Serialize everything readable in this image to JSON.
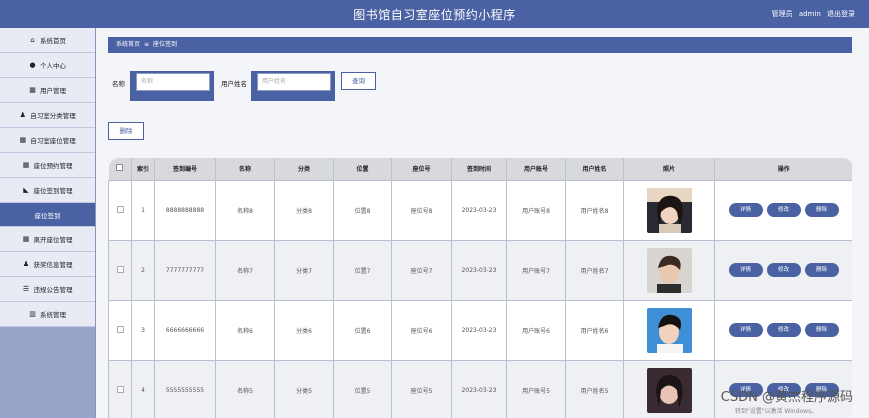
{
  "header": {
    "title": "图书馆自习室座位预约小程序",
    "user_role": "管理员",
    "username": "admin",
    "logout": "退出登录"
  },
  "sidebar": {
    "items": [
      {
        "icon": "home-icon",
        "label": "系统首页"
      },
      {
        "icon": "user-icon",
        "label": "个人中心"
      },
      {
        "icon": "grid-icon",
        "label": "用户管理"
      },
      {
        "icon": "person-icon",
        "label": "自习室分类管理"
      },
      {
        "icon": "grid-icon",
        "label": "自习室座位管理"
      },
      {
        "icon": "grid-icon",
        "label": "座位预约管理"
      },
      {
        "icon": "thumb-icon",
        "label": "座位签到管理"
      },
      {
        "icon": "",
        "label": "座位签到"
      },
      {
        "icon": "grid-icon",
        "label": "离开座位管理"
      },
      {
        "icon": "person-icon",
        "label": "获奖信息管理"
      },
      {
        "icon": "sliders-icon",
        "label": "违规公告管理"
      },
      {
        "icon": "chart-icon",
        "label": "系统管理"
      }
    ],
    "active_index": 7
  },
  "breadcrumb": {
    "home": "系统首页",
    "sep": "≡",
    "current": "座位签到"
  },
  "search": {
    "name_label": "名称",
    "name_placeholder": "名称",
    "user_label": "用户姓名",
    "user_placeholder": "用户姓名",
    "query_button": "查询"
  },
  "delete_button": "删除",
  "table": {
    "headers": [
      "",
      "索引",
      "签到编号",
      "名称",
      "分类",
      "位置",
      "座位号",
      "签到时间",
      "用户账号",
      "用户姓名",
      "照片",
      "操作"
    ],
    "ops": [
      "详情",
      "修改",
      "删除"
    ],
    "rows": [
      {
        "index": "1",
        "code": "8888888888",
        "name": "名称8",
        "category": "分类8",
        "location": "位置8",
        "seat": "座位号8",
        "time": "2023-03-23",
        "account": "用户账号8",
        "user": "用户姓名8"
      },
      {
        "index": "2",
        "code": "7777777777",
        "name": "名称7",
        "category": "分类7",
        "location": "位置7",
        "seat": "座位号7",
        "time": "2023-03-23",
        "account": "用户账号7",
        "user": "用户姓名7"
      },
      {
        "index": "3",
        "code": "6666666666",
        "name": "名称6",
        "category": "分类6",
        "location": "位置6",
        "seat": "座位号6",
        "time": "2023-03-23",
        "account": "用户账号6",
        "user": "用户姓名6"
      },
      {
        "index": "4",
        "code": "5555555555",
        "name": "名称5",
        "category": "分类5",
        "location": "位置5",
        "seat": "座位号5",
        "time": "2023-03-23",
        "account": "用户账号5",
        "user": "用户姓名5"
      }
    ]
  },
  "watermark": "CSDN @黄杰程序源码",
  "activate_windows": "转到\"设置\"以激活 Windows。"
}
